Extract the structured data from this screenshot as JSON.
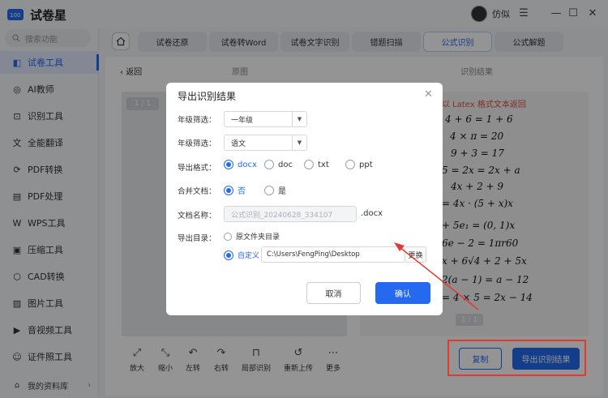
{
  "app": {
    "name": "试卷星"
  },
  "user": {
    "name": "仿似"
  },
  "search": {
    "placeholder": "搜索功能"
  },
  "sidebar": {
    "items": [
      {
        "label": "试卷工具",
        "icon": "layers-icon",
        "active": true
      },
      {
        "label": "AI教师",
        "icon": "ai-teacher-icon"
      },
      {
        "label": "识别工具",
        "icon": "scan-icon"
      },
      {
        "label": "全能翻译",
        "icon": "translate-icon"
      },
      {
        "label": "PDF转换",
        "icon": "pdf-convert-icon"
      },
      {
        "label": "PDF处理",
        "icon": "pdf-process-icon"
      },
      {
        "label": "WPS工具",
        "icon": "wps-icon"
      },
      {
        "label": "压缩工具",
        "icon": "compress-icon"
      },
      {
        "label": "CAD转换",
        "icon": "cad-icon"
      },
      {
        "label": "图片工具",
        "icon": "image-icon"
      },
      {
        "label": "音视频工具",
        "icon": "media-icon"
      },
      {
        "label": "证件照工具",
        "icon": "id-photo-icon"
      }
    ],
    "my_library": "我的资料库"
  },
  "tabs": [
    {
      "label": "试卷还原"
    },
    {
      "label": "试卷转Word"
    },
    {
      "label": "试卷文字识别"
    },
    {
      "label": "错题扫描"
    },
    {
      "label": "公式识别",
      "active": true
    },
    {
      "label": "公式解题"
    }
  ],
  "content": {
    "back": "返回",
    "original_header": "原图",
    "result_header": "识别结果",
    "page_indicator": "1 / 1",
    "result_note": "以 Latex 格式文本返回",
    "formulas": [
      "4 + 6 = 1 + 6",
      "4 × π = 20",
      "9 + 3 = 17",
      "5 = 2x = 2x + a",
      "4x + 2 + 9",
      "= 4x · (5 + x)x",
      "+ 5e₁ = (0, 1)x",
      "6e − 2 = 1πr60",
      "x + 6√4 + 2 + 5x",
      "2(a − 1) = a − 12",
      "= 4 × 5 = 2x − 14"
    ],
    "result_page_indicator": "1 / 1"
  },
  "toolbar": [
    {
      "label": "放大",
      "icon": "zoom-in-icon"
    },
    {
      "label": "缩小",
      "icon": "zoom-out-icon"
    },
    {
      "label": "左转",
      "icon": "rotate-left-icon"
    },
    {
      "label": "右转",
      "icon": "rotate-right-icon"
    },
    {
      "label": "局部识别",
      "icon": "crop-icon"
    },
    {
      "label": "重新上传",
      "icon": "reupload-icon"
    },
    {
      "label": "更多",
      "icon": "more-icon"
    }
  ],
  "actions": {
    "copy": "复制",
    "export": "导出识别结果"
  },
  "modal": {
    "title": "导出识别结果",
    "grade_label": "年级筛选：",
    "grade_value": "一年级",
    "subject_label": "年级筛选：",
    "subject_value": "语文",
    "format_label": "导出格式：",
    "formats": [
      "docx",
      "doc",
      "txt",
      "ppt"
    ],
    "selected_format": "docx",
    "merge_label": "合并文档：",
    "merge_options": [
      "否",
      "是"
    ],
    "filename_label": "文档名称：",
    "filename_value": "公式识别_20240628_334107",
    "filename_ext": ".docx",
    "dir_label": "导出目录：",
    "dir_option_source": "原文件夹目录",
    "dir_option_custom": "自定义",
    "dir_path": "C:\\Users\\FengPing\\Desktop",
    "change_button": "更换",
    "cancel": "取消",
    "confirm": "确认"
  },
  "colors": {
    "accent": "#2469f0",
    "highlight": "#e23a2f"
  }
}
